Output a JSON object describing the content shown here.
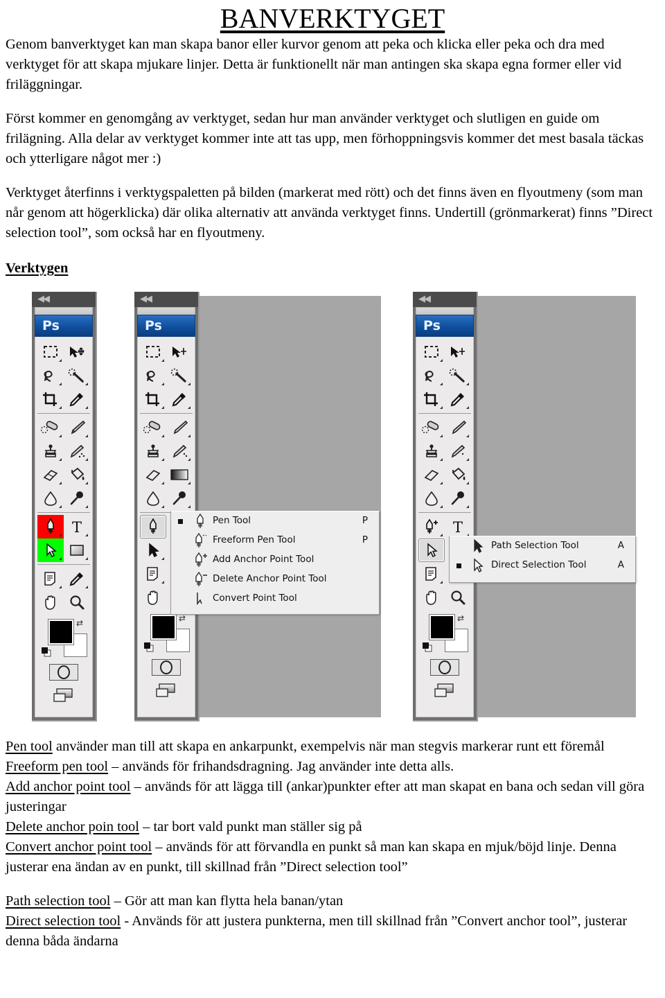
{
  "document": {
    "title": "BANVERKTYGET",
    "intro_paragraph_1": "Genom banverktyget kan man skapa banor eller kurvor genom att peka och klicka eller peka och dra med verktyget för att skapa mjukare linjer. Detta är funktionellt när man antingen ska skapa egna former eller vid friläggningar.",
    "intro_paragraph_2": "Först kommer en genomgång av verktyget, sedan hur man använder verktyget och slutligen en guide om frilägning. Alla delar av verktyget kommer inte att tas upp, men förhoppningsvis kommer det mest basala täckas och ytterligare något mer :)",
    "intro_paragraph_3": "Verktyget återfinns i verktygspaletten på bilden (markerat med rött) och det finns även en flyoutmeny (som man når genom att högerklicka) där olika alternativ att använda verktyget finns. Undertill (grönmarkerat) finns ”Direct selection tool”, som också har en flyoutmeny.",
    "section_heading": "Verktygen"
  },
  "figure": {
    "app_logo": "Ps",
    "collapse_arrows": "◀◀",
    "highlight_red": "#ff0000",
    "highlight_green": "#00ff00",
    "panel_background": "#eceaea",
    "canvas_background": "#a6a6a6",
    "chrome_background": "#6f6f6f",
    "logo_blue": "#0f4f9e",
    "pen_flyout": {
      "items": [
        {
          "label": "Pen Tool",
          "shortcut": "P",
          "selected": true,
          "icon": "pen-icon"
        },
        {
          "label": "Freeform Pen Tool",
          "shortcut": "P",
          "selected": false,
          "icon": "freeform-pen-icon"
        },
        {
          "label": "Add Anchor Point Tool",
          "shortcut": "",
          "selected": false,
          "icon": "add-anchor-icon"
        },
        {
          "label": "Delete Anchor Point Tool",
          "shortcut": "",
          "selected": false,
          "icon": "delete-anchor-icon"
        },
        {
          "label": "Convert Point Tool",
          "shortcut": "",
          "selected": false,
          "icon": "convert-point-icon"
        }
      ]
    },
    "selection_flyout": {
      "items": [
        {
          "label": "Path Selection Tool",
          "shortcut": "A",
          "selected": false,
          "icon": "path-selection-icon"
        },
        {
          "label": "Direct Selection Tool",
          "shortcut": "A",
          "selected": true,
          "icon": "direct-selection-icon"
        }
      ]
    }
  },
  "descriptions": {
    "lines": [
      {
        "term": "Pen tool",
        "rest": " använder man till att skapa en ankarpunkt, exempelvis när man stegvis markerar runt ett föremål"
      },
      {
        "term": "Freeform pen tool",
        "rest": " – används för frihandsdragning. Jag använder inte detta alls."
      },
      {
        "term": "Add anchor point tool",
        "rest": " – används för att lägga till (ankar)punkter efter att man skapat en bana och sedan vill göra justeringar"
      },
      {
        "term": "Delete anchor poin tool",
        "rest": " – tar bort vald punkt man ställer sig på"
      },
      {
        "term": "Convert anchor point tool",
        "rest": " – används för att förvandla en punkt så man kan skapa en mjuk/böjd linje. Denna justerar ena ändan av en punkt, till skillnad från ”Direct selection tool”"
      }
    ],
    "lines2": [
      {
        "term": "Path selection tool",
        "rest": " – Gör att man kan flytta hela banan/ytan"
      },
      {
        "term": "Direct selection tool",
        "rest": " - Används för att justera punkterna, men till skillnad från ”Convert anchor tool”, justerar denna båda ändarna"
      }
    ]
  }
}
